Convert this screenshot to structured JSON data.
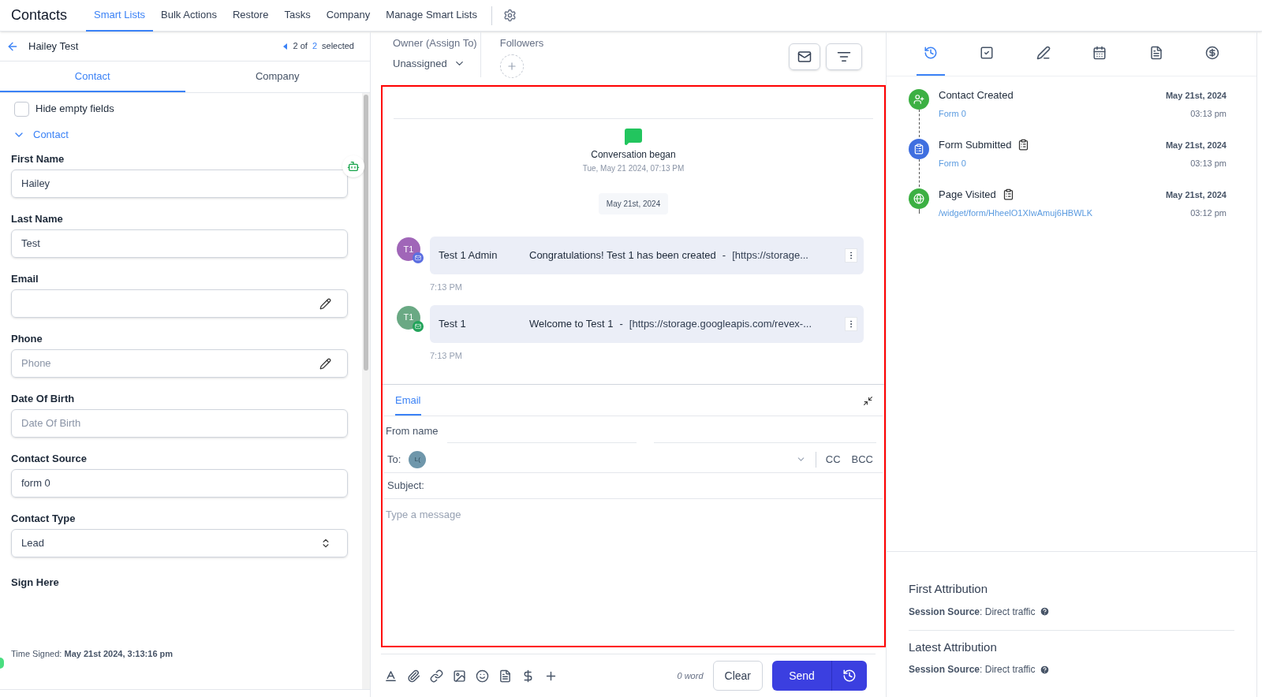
{
  "nav": {
    "title": "Contacts",
    "tabs": [
      {
        "label": "Smart Lists",
        "selected": true
      },
      {
        "label": "Bulk Actions",
        "selected": false
      },
      {
        "label": "Restore",
        "selected": false
      },
      {
        "label": "Tasks",
        "selected": false
      },
      {
        "label": "Company",
        "selected": false
      },
      {
        "label": "Manage Smart Lists",
        "selected": false
      }
    ]
  },
  "contact_header": {
    "name": "Hailey Test",
    "counter_prefix": "2 of",
    "counter_total": "2",
    "counter_suffix": "selected"
  },
  "detail_tabs": [
    {
      "label": "Contact",
      "selected": true
    },
    {
      "label": "Company",
      "selected": false
    }
  ],
  "hide_empty_fields": {
    "label": "Hide empty fields",
    "checked": false
  },
  "section": {
    "title": "Contact",
    "expanded": true
  },
  "fields": [
    {
      "label": "First Name",
      "kind": "text",
      "value": "Hailey"
    },
    {
      "label": "Last Name",
      "kind": "text",
      "value": "Test"
    },
    {
      "label": "Email",
      "kind": "editable"
    },
    {
      "label": "Phone",
      "kind": "editable",
      "placeholder": "Phone"
    },
    {
      "label": "Date Of Birth",
      "kind": "text",
      "placeholder": "Date Of Birth"
    },
    {
      "label": "Contact Source",
      "kind": "text",
      "value": "form 0"
    },
    {
      "label": "Contact Type",
      "kind": "select",
      "value": "Lead"
    }
  ],
  "signature": {
    "label": "Sign Here",
    "time_signed": "Time Signed: **May 21st 2024, 3:13:16 pm**"
  },
  "owner": {
    "label": "Owner (Assign To)",
    "value": "Unassigned"
  },
  "followers": {
    "label": "Followers"
  },
  "conversation": {
    "event": "Conversation began",
    "event_time": "Tue, May 21 2024, 07:13 PM",
    "date_chip": "May 21st, 2024",
    "messages": [
      {
        "initials": "T1",
        "color": "#a066b8",
        "badge": {
          "color": "#5b6ee1"
        },
        "sender": "Test 1 Admin",
        "subject": "Congratulations! Test 1 has been created",
        "separator": "-",
        "preview": "[https://storage...",
        "time": "7:13 PM"
      },
      {
        "initials": "T1",
        "color": "#6aa984",
        "badge": {
          "color": "#22a35a"
        },
        "sender": "Test 1",
        "subject": "Welcome to Test 1",
        "separator": "-",
        "preview": "[https://storage.googleapis.com/revex-...",
        "time": "7:13 PM"
      }
    ]
  },
  "composer": {
    "tabs": [
      {
        "label": "Email",
        "selected": true
      }
    ],
    "from_label": "From name",
    "to_label": "To:",
    "recipient_initials": "L(",
    "cc": "CC",
    "bcc": "BCC",
    "subject_label": "Subject:",
    "placeholder": "Type a message",
    "word_count": "0 word",
    "clear": "Clear",
    "send": "Send"
  },
  "activity_tabs": [
    {
      "kind": "activity",
      "selected": true
    },
    {
      "kind": "task",
      "selected": false
    },
    {
      "kind": "note",
      "selected": false
    },
    {
      "kind": "appointment",
      "selected": false
    },
    {
      "kind": "document",
      "selected": false
    },
    {
      "kind": "payment",
      "selected": false
    }
  ],
  "timeline": [
    {
      "kind": "contact",
      "color": "#3cb043",
      "title": "Contact Created",
      "has_clipboard": false,
      "link": "Form 0",
      "date": "May 21st, 2024",
      "time": "03:13 pm"
    },
    {
      "kind": "form",
      "color": "#3f6fe0",
      "title": "Form Submitted",
      "has_clipboard": true,
      "link": "Form 0",
      "date": "May 21st, 2024",
      "time": "03:13 pm"
    },
    {
      "kind": "page",
      "color": "#3cb043",
      "title": "Page Visited",
      "has_clipboard": true,
      "link": "/widget/form/HheelO1XIwAmuj6HBWLK",
      "date": "May 21st, 2024",
      "time": "03:12 pm"
    }
  ],
  "attribution": [
    {
      "title": "First Attribution",
      "source": "**Session Source**: Direct traffic"
    },
    {
      "title": "Latest Attribution",
      "source": "**Session Source**: Direct traffic"
    }
  ]
}
